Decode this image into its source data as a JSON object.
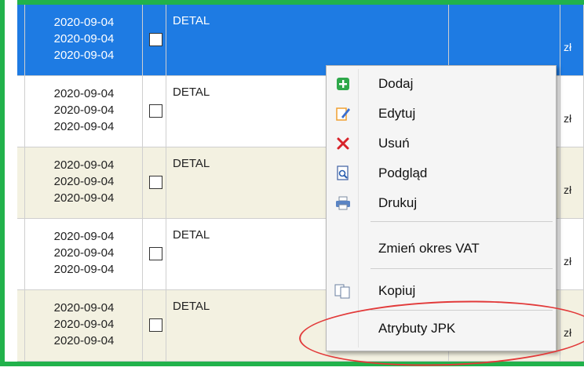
{
  "rows": [
    {
      "dates": [
        "2020-09-04",
        "2020-09-04",
        "2020-09-04"
      ],
      "name": "DETAL",
      "currency": "zł"
    },
    {
      "dates": [
        "2020-09-04",
        "2020-09-04",
        "2020-09-04"
      ],
      "name": "DETAL",
      "currency": "zł"
    },
    {
      "dates": [
        "2020-09-04",
        "2020-09-04",
        "2020-09-04"
      ],
      "name": "DETAL",
      "currency": "zł"
    },
    {
      "dates": [
        "2020-09-04",
        "2020-09-04",
        "2020-09-04"
      ],
      "name": "DETAL",
      "currency": "zł"
    },
    {
      "dates": [
        "2020-09-04",
        "2020-09-04",
        "2020-09-04"
      ],
      "name": "DETAL",
      "currency": "zł"
    }
  ],
  "context_menu": {
    "items": [
      {
        "label": "Dodaj",
        "icon": "add-icon"
      },
      {
        "label": "Edytuj",
        "icon": "edit-icon"
      },
      {
        "label": "Usuń",
        "icon": "delete-icon"
      },
      {
        "label": "Podgląd",
        "icon": "preview-icon"
      },
      {
        "label": "Drukuj",
        "icon": "print-icon"
      },
      {
        "label": "Zmień okres VAT",
        "icon": ""
      },
      {
        "label": "Kopiuj",
        "icon": "copy-icon"
      },
      {
        "label": "Atrybuty JPK",
        "icon": ""
      }
    ]
  },
  "colors": {
    "frame_green": "#21b24b",
    "selection_blue": "#1e7be3",
    "alt_row": "#f3f1e1",
    "highlight_red": "#e23a3a"
  }
}
